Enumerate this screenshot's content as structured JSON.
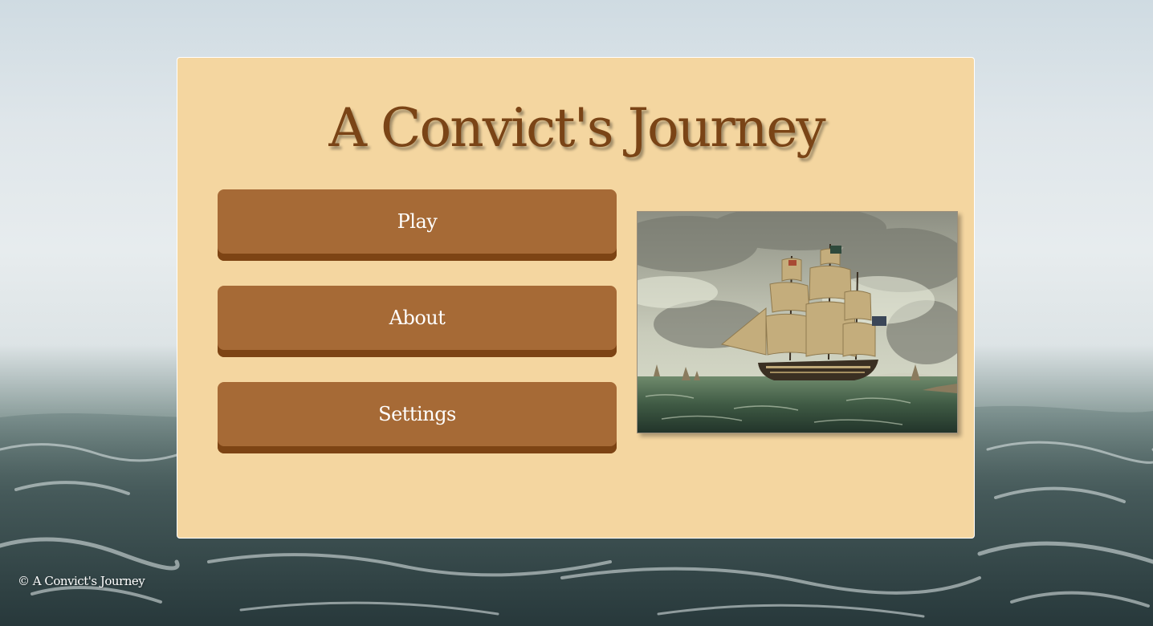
{
  "game": {
    "title": "A Convict's Journey"
  },
  "menu": {
    "play_label": "Play",
    "about_label": "About",
    "settings_label": "Settings"
  },
  "footer": {
    "copyright": "© A Convict's Journey"
  },
  "colors": {
    "panel_background": "#f4d6a0",
    "title_text": "#7a4416",
    "button_face": "#a66a36",
    "button_edge": "#7d4414",
    "button_text": "#ffffff"
  },
  "images": {
    "background": "stormy-sea-background",
    "painting": "sailing-ship-painting"
  }
}
